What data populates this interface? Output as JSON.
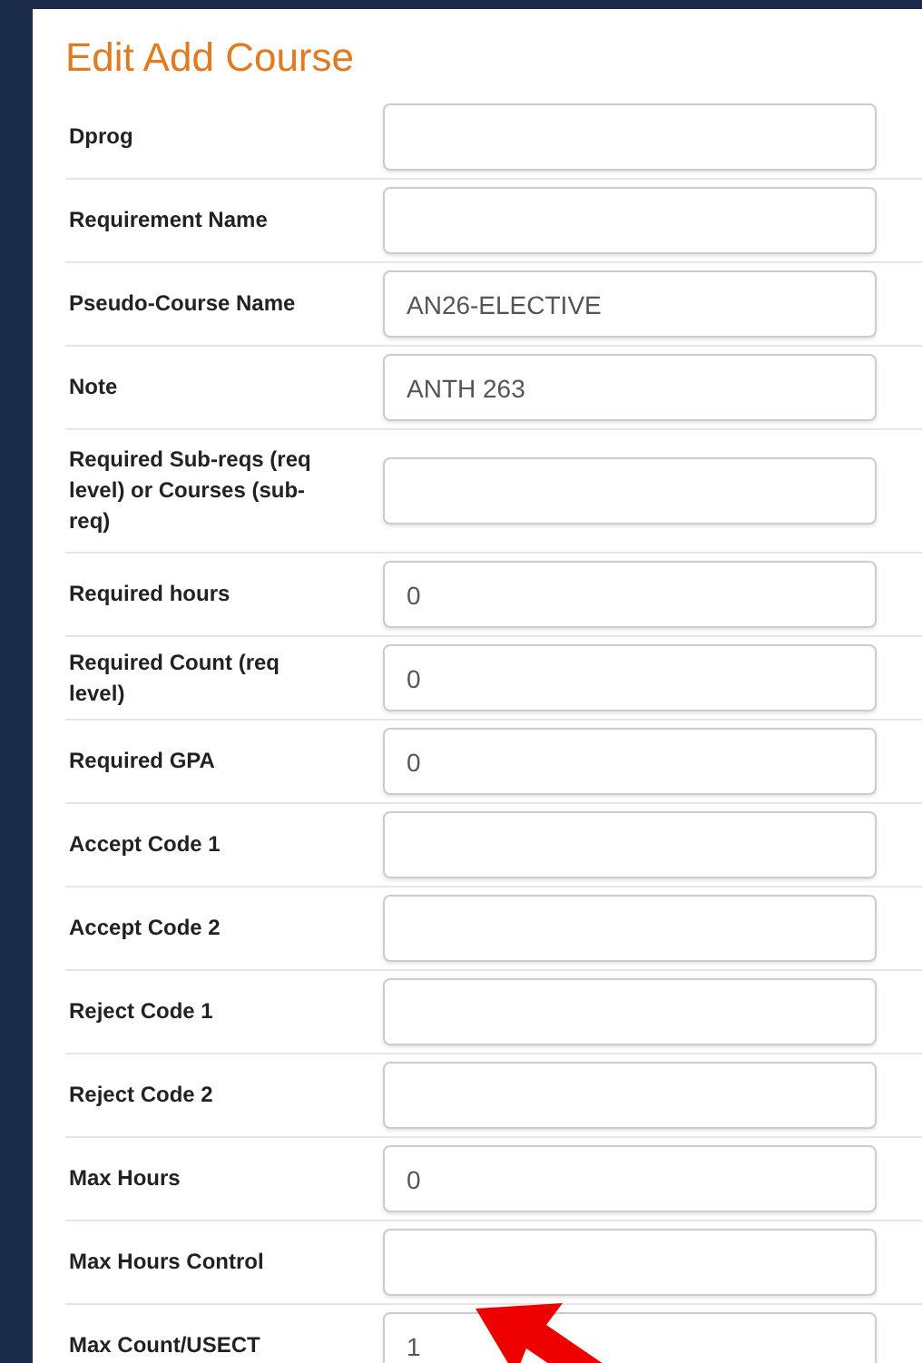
{
  "title": "Edit Add Course",
  "fields": [
    {
      "label": "Dprog"
    },
    {
      "label": "Requirement Name"
    },
    {
      "label": "Pseudo-Course Name",
      "value": "AN26-ELECTIVE"
    },
    {
      "label": "Note",
      "value": "ANTH 263"
    },
    {
      "label": "Required Sub-reqs (req level) or Courses (sub-req)"
    },
    {
      "label": "Required hours",
      "value": "0"
    },
    {
      "label": "Required Count (req level)",
      "value": "0"
    },
    {
      "label": "Required GPA",
      "value": "0"
    },
    {
      "label": "Accept Code 1"
    },
    {
      "label": "Accept Code 2"
    },
    {
      "label": "Reject Code 1"
    },
    {
      "label": "Reject Code 2"
    },
    {
      "label": "Max Hours",
      "value": "0"
    },
    {
      "label": "Max Hours Control"
    },
    {
      "label": "Max Count/USECT",
      "value": "1"
    }
  ]
}
